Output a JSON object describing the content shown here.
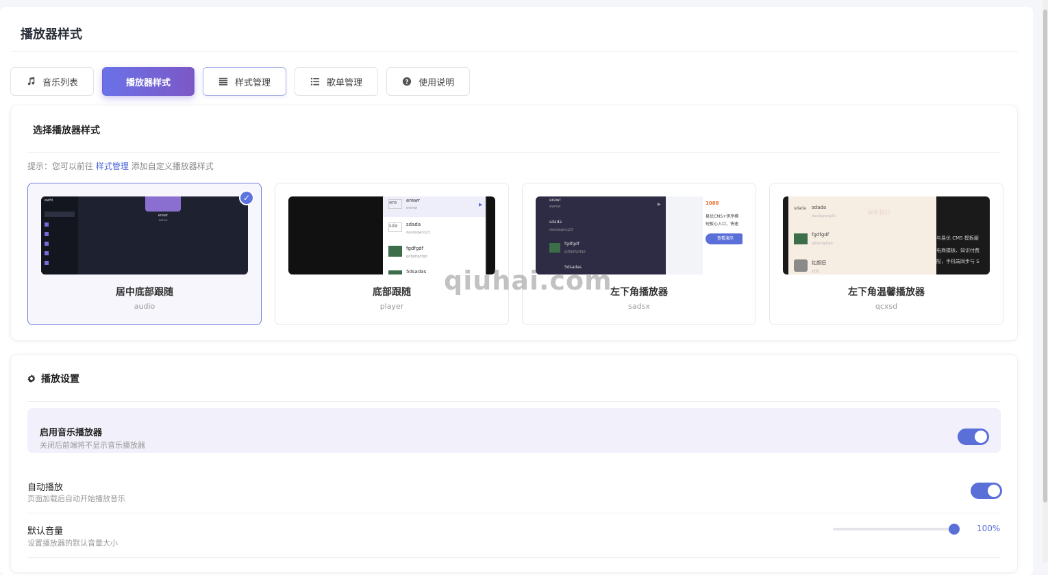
{
  "page": {
    "title": "播放器样式"
  },
  "tabs": [
    {
      "label": "音乐列表",
      "icon": "music-icon"
    },
    {
      "label": "播放器样式",
      "icon": ""
    },
    {
      "label": "样式管理",
      "icon": "list-icon"
    },
    {
      "label": "歌单管理",
      "icon": "list-bullets-icon"
    },
    {
      "label": "使用说明",
      "icon": "question-circle-icon"
    }
  ],
  "select_card": {
    "title": "选择播放器样式",
    "hint_prefix": "提示：您可以前往",
    "hint_link": "样式管理",
    "hint_suffix": "添加自定义播放器样式",
    "styles": [
      {
        "name": "居中底部跟随",
        "code": "audio",
        "selected": true
      },
      {
        "name": "底部跟随",
        "code": "player",
        "selected": false
      },
      {
        "name": "左下角播放器",
        "code": "sadsx",
        "selected": false
      },
      {
        "name": "左下角温馨播放器",
        "code": "qcxsd",
        "selected": false
      }
    ],
    "previews": {
      "p2_items": [
        {
          "title": "erewr",
          "sub": "ewrew",
          "img_alt": "ere"
        },
        {
          "title": "sdada",
          "sub": "dasdaqwcq23",
          "img_alt": "sda"
        },
        {
          "title": "fgdfgdf",
          "sub": "gdfgdfgdfgd",
          "img_alt": ""
        },
        {
          "title": "5dsadas",
          "sub": "",
          "img_alt": ""
        }
      ],
      "p3_items": [
        {
          "title": "erewr",
          "sub": "ewrew"
        },
        {
          "title": "sdada",
          "sub": "dasdaqwcq23"
        },
        {
          "title": "fgdfgdf",
          "sub": "gdfgdfgdfgd"
        },
        {
          "title": "5dsadas",
          "sub": ""
        }
      ],
      "p3_side": {
        "count": "1088",
        "text1": "易优CMS+伊序模",
        "text2": "短板心入口，快速",
        "button": "查看演示"
      },
      "p4_items": [
        {
          "title": "sdada",
          "sub": "dasdaqwcq23",
          "img_alt": "sdada"
        },
        {
          "title": "fgdfgdf",
          "sub": "gdfgdfgdfgd",
          "img_alt": ""
        },
        {
          "title": "红颜旧",
          "sub": "刘涛",
          "img_alt": ""
        }
      ],
      "p4_overlay": {
        "heading": "联系我们",
        "line1": "与易优 CMS 模板服",
        "line2": "电商模板、知识付费",
        "line3": "配，手机端同步与 S"
      },
      "p1_center": {
        "title": "erewr",
        "sub": "ewrew",
        "logo": "ewfd"
      }
    }
  },
  "settings": {
    "title": "播放设置",
    "rows": [
      {
        "label": "启用音乐播放器",
        "desc": "关闭后前端将不显示音乐播放器",
        "on": true
      },
      {
        "label": "自动播放",
        "desc": "页面加载后自动开始播放音乐",
        "on": true
      },
      {
        "label": "默认音量",
        "desc": "设置播放器的默认音量大小"
      }
    ],
    "volume": {
      "value": 1.0,
      "display": "100%"
    }
  },
  "watermark": "qiuhai.com",
  "colors": {
    "accent": "#5b6fd8",
    "accent_gradient_end": "#7c58c6"
  }
}
